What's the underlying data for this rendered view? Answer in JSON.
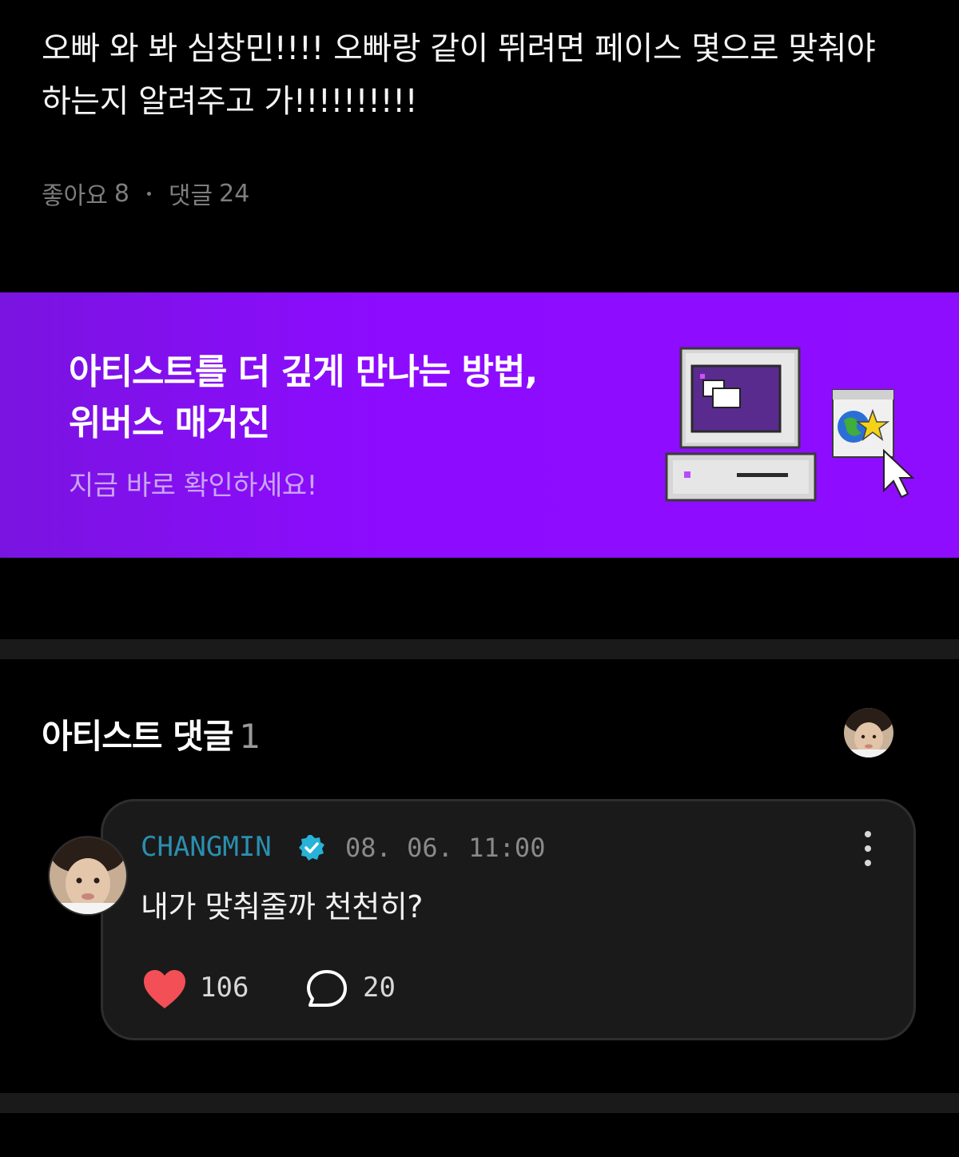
{
  "post": {
    "text_line1": "오빠 와 봐 심창민!!!! 오빠랑 같이 뛰려면 페이스 몇으로 맞춰야",
    "text_line2": "하는지 알려주고 가!!!!!!!!!!",
    "likes_label": "좋아요",
    "likes_count": "8",
    "comments_label": "댓글",
    "comments_count": "24"
  },
  "banner": {
    "title_line1": "아티스트를 더 깊게 만나는 방법,",
    "title_line2": "위버스 매거진",
    "subtitle": "지금 바로 확인하세요!",
    "bg_color": "#8e0dff",
    "art_icon": "retro-computer-icon"
  },
  "artist_comments": {
    "title": "아티스트 댓글",
    "count": "1",
    "avatar_icon": "artist-avatar"
  },
  "comment": {
    "author": "CHANGMIN",
    "verified_icon": "verified-badge-icon",
    "timestamp": "08. 06. 11:00",
    "text": "내가 맞춰줄까 천천히?",
    "like_count": "106",
    "reply_count": "20",
    "like_color": "#f24f56",
    "author_color": "#2a8fb0"
  }
}
